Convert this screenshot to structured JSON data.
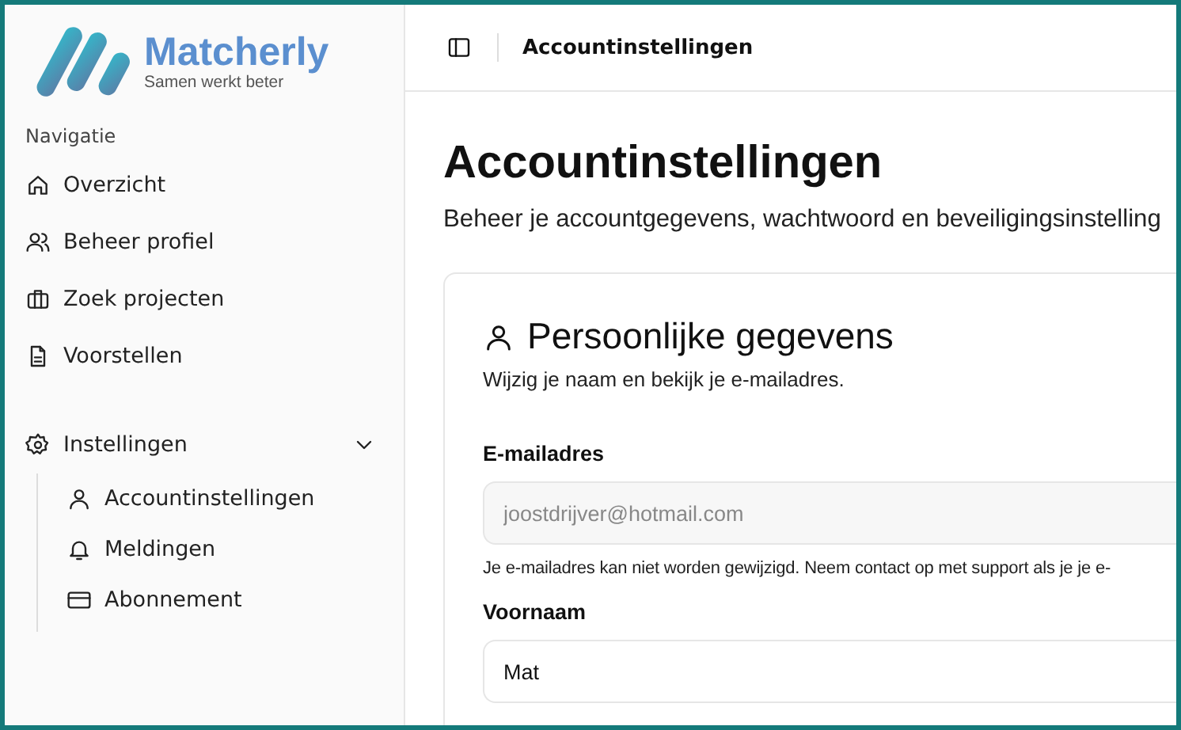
{
  "sidebar": {
    "logo": {
      "name": "Matcherly",
      "tagline": "Samen werkt beter"
    },
    "section_label": "Navigatie",
    "items": [
      {
        "label": "Overzicht",
        "selected": false
      },
      {
        "label": "Beheer profiel",
        "selected": false
      },
      {
        "label": "Zoek projecten",
        "selected": false
      },
      {
        "label": "Voorstellen",
        "selected": false
      }
    ],
    "settings_group": {
      "label": "Instellingen",
      "expanded": true,
      "children": [
        {
          "label": "Accountinstellingen",
          "selected": false
        },
        {
          "label": "Meldingen",
          "selected": false
        },
        {
          "label": "Abonnement",
          "selected": false
        }
      ]
    }
  },
  "header": {
    "breadcrumb": "Accountinstellingen"
  },
  "page": {
    "title": "Accountinstellingen",
    "subtitle": "Beheer je accountgegevens, wachtwoord en beveiligingsinstelling"
  },
  "card": {
    "title": "Persoonlijke gegevens",
    "description": "Wijzig je naam en bekijk je e-mailadres.",
    "fields": [
      {
        "label": "E-mailadres",
        "value": "joostdrijver@hotmail.com",
        "disabled": true,
        "hint": "Je e-mailadres kan niet worden gewijzigd. Neem contact op met support als je je e-"
      },
      {
        "label": "Voornaam",
        "value": "Mat",
        "disabled": false
      }
    ]
  }
}
